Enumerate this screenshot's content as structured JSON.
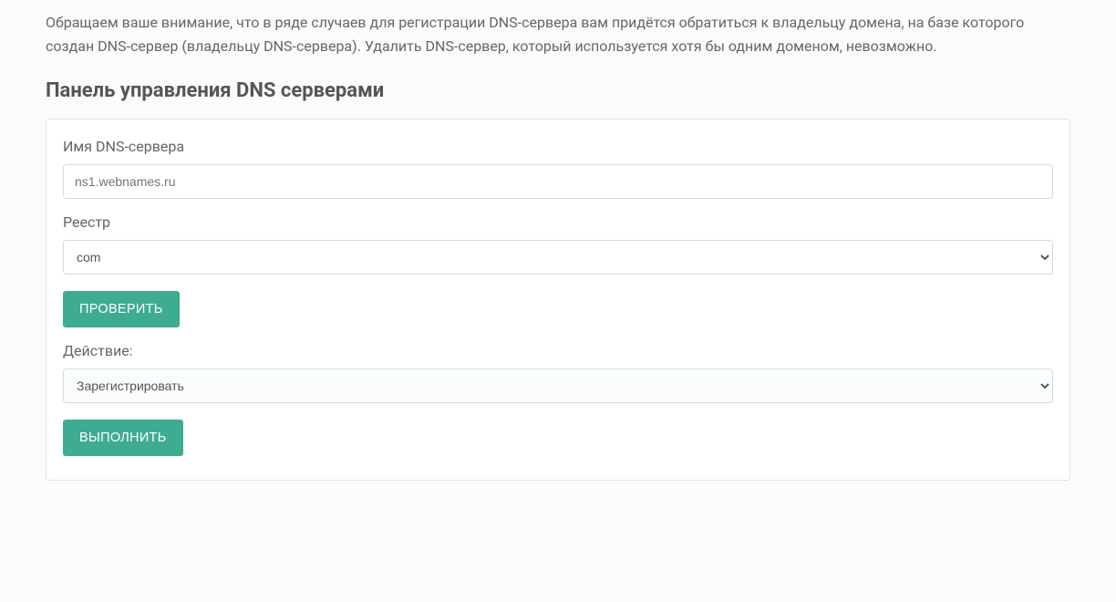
{
  "notice": "Обращаем ваше внимание, что в ряде случаев для регистрации DNS-сервера вам придётся обратиться к владельцу домена, на базе которого создан DNS-сервер (владельцу DNS-сервера). Удалить DNS-сервер, который используется хотя бы одним доменом, невозможно.",
  "panel_title": "Панель управления DNS серверами",
  "form": {
    "dns_name_label": "Имя DNS-сервера",
    "dns_name_placeholder": "ns1.webnames.ru",
    "dns_name_value": "",
    "registry_label": "Реестр",
    "registry_selected": "com",
    "check_button": "ПРОВЕРИТЬ",
    "action_label": "Действие:",
    "action_selected": "Зарегистрировать",
    "submit_button": "ВЫПОЛНИТЬ"
  }
}
